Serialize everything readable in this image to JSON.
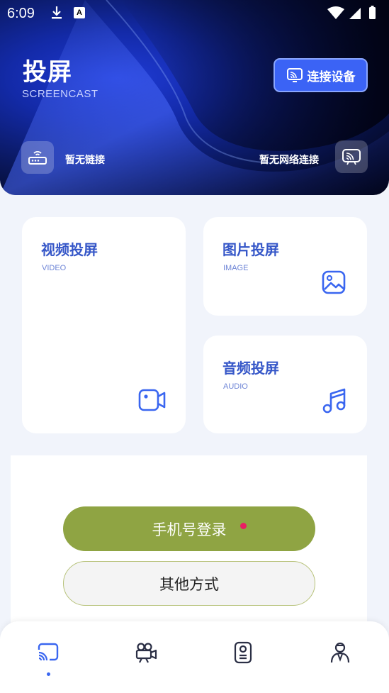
{
  "status_bar": {
    "time": "6:09",
    "notif_badge": "A"
  },
  "header": {
    "title": "投屏",
    "subtitle": "SCREENCAST",
    "connect_button": "连接设备",
    "link_status": "暂无链接",
    "network_status": "暂无网络连接"
  },
  "cards": {
    "video": {
      "title": "视频投屏",
      "subtitle": "VIDEO",
      "icon": "video-camera-icon"
    },
    "image": {
      "title": "图片投屏",
      "subtitle": "IMAGE",
      "icon": "image-icon"
    },
    "audio": {
      "title": "音频投屏",
      "subtitle": "AUDIO",
      "icon": "music-note-icon"
    }
  },
  "login": {
    "phone_login": "手机号登录",
    "other_methods": "其他方式"
  },
  "bottom_nav": {
    "items": [
      {
        "icon": "cast-icon",
        "active": true
      },
      {
        "icon": "movie-camera-icon",
        "active": false
      },
      {
        "icon": "remote-control-icon",
        "active": false
      },
      {
        "icon": "user-icon",
        "active": false
      }
    ]
  },
  "colors": {
    "accent": "#3a66f0",
    "card_title": "#3657c8",
    "phone_button": "#8fa443",
    "badge_dot": "#e91e63"
  }
}
